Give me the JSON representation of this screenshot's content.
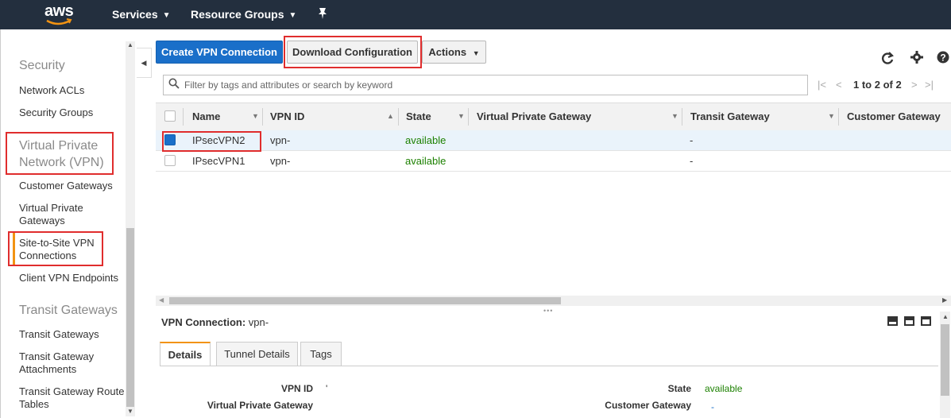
{
  "topbar": {
    "logo": "aws",
    "services": "Services",
    "resource_groups": "Resource Groups",
    "pin_icon": "pushpin-icon"
  },
  "sidebar": {
    "security_heading": "Security",
    "network_acls": "Network ACLs",
    "security_groups": "Security Groups",
    "vpn_heading_line1": "Virtual Private",
    "vpn_heading_line2": "Network (VPN)",
    "customer_gateways": "Customer Gateways",
    "vpg_line1": "Virtual Private",
    "vpg_line2": "Gateways",
    "s2s_line1": "Site-to-Site VPN",
    "s2s_line2": "Connections",
    "client_vpn": "Client VPN Endpoints",
    "transit_heading": "Transit Gateways",
    "transit_gateways": "Transit Gateways",
    "tga_line1": "Transit Gateway",
    "tga_line2": "Attachments",
    "tgrt_line1": "Transit Gateway Route",
    "tgrt_line2": "Tables"
  },
  "toolbar": {
    "create_vpn": "Create VPN Connection",
    "download_config": "Download Configuration",
    "actions": "Actions"
  },
  "filter": {
    "placeholder": "Filter by tags and attributes or search by keyword"
  },
  "pager": {
    "text": "1 to 2 of 2"
  },
  "table": {
    "columns": [
      "Name",
      "VPN ID",
      "State",
      "Virtual Private Gateway",
      "Transit Gateway",
      "Customer Gateway"
    ],
    "rows": [
      {
        "name": "IPsecVPN2",
        "vpn_id": "vpn-",
        "state": "available",
        "vpg": "",
        "tgw": "-",
        "selected": true
      },
      {
        "name": "IPsecVPN1",
        "vpn_id": "vpn-",
        "state": "available",
        "vpg": "",
        "tgw": "-",
        "selected": false
      }
    ]
  },
  "detail": {
    "title_label": "VPN Connection:",
    "title_value": "vpn-",
    "tabs": [
      "Details",
      "Tunnel Details",
      "Tags"
    ],
    "vpn_id_label": "VPN ID",
    "vpn_id_value": "'",
    "state_label": "State",
    "state_value": "available",
    "vpg_label": "Virtual Private Gateway",
    "cgw_label": "Customer Gateway",
    "cgw_value": "-"
  },
  "colors": {
    "topbar": "#232f3e",
    "primary": "#1a6fc9",
    "status_ok": "#1d8102",
    "highlight_box": "#e02d2d",
    "accent": "#f29312"
  }
}
